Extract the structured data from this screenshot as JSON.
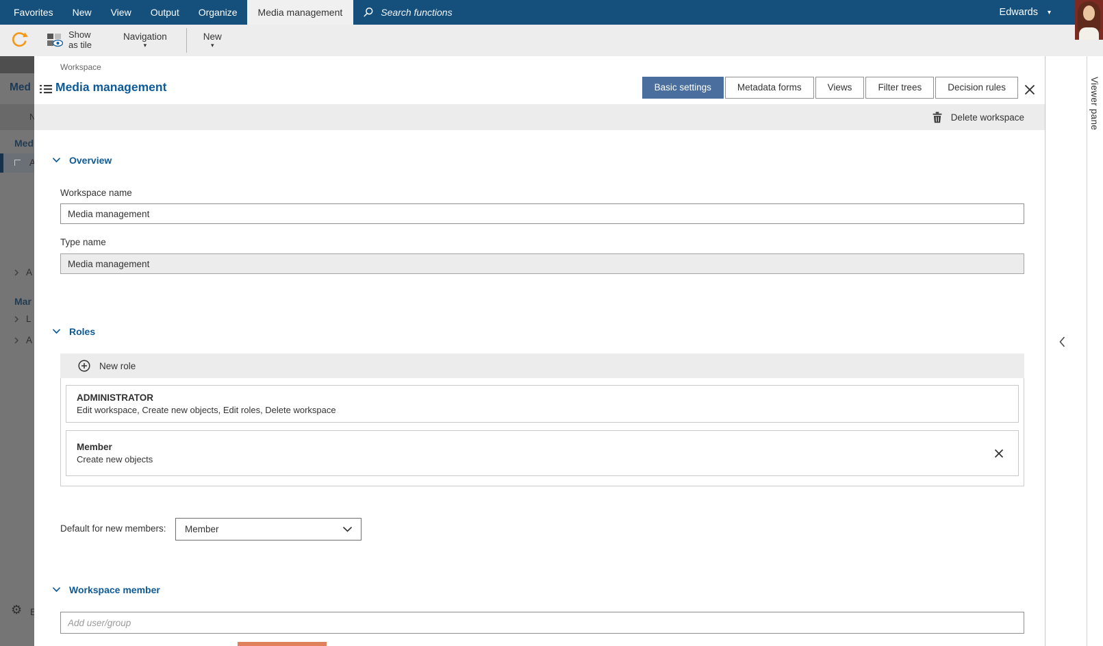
{
  "colors": {
    "navbar": "#154f7c",
    "accent_blue": "#0d5a96",
    "active_tab": "#4a6f9e",
    "refresh_orange": "#f49819",
    "salmon_bar": "#e0815e",
    "bar_gray": "#ececec"
  },
  "topnav": {
    "items": [
      "Favorites",
      "New",
      "View",
      "Output",
      "Organize"
    ],
    "active_item": "Media management",
    "search_placeholder": "Search functions",
    "user_name": "Edwards"
  },
  "toolbar": {
    "show_as_tile": "Show as tile",
    "navigation": "Navigation",
    "new": "New"
  },
  "workspace_panel": {
    "breadcrumb": "Workspace",
    "title": "Media management",
    "tabs": [
      {
        "label": "Basic settings",
        "active": true
      },
      {
        "label": "Metadata forms",
        "active": false
      },
      {
        "label": "Views",
        "active": false
      },
      {
        "label": "Filter trees",
        "active": false
      },
      {
        "label": "Decision rules",
        "active": false
      }
    ],
    "delete_button": "Delete workspace",
    "overview": {
      "heading": "Overview",
      "workspace_name_label": "Workspace name",
      "workspace_name_value": "Media management",
      "type_name_label": "Type name",
      "type_name_value": "Media management"
    },
    "roles": {
      "heading": "Roles",
      "new_role_button": "New role",
      "cards": [
        {
          "name": "ADMINISTRATOR",
          "permissions": "Edit workspace, Create new objects, Edit roles, Delete workspace"
        },
        {
          "name": "Member",
          "permissions": "Create new objects"
        }
      ],
      "default_label": "Default for new members:",
      "default_value": "Member"
    },
    "members": {
      "heading": "Workspace member",
      "add_placeholder": "Add user/group"
    }
  },
  "viewer_pane": {
    "label": "Viewer pane"
  },
  "dimmed_background": {
    "page_title": "Med",
    "toolbar_text": "N",
    "group1": "Med",
    "selected_item": "A",
    "item_a": "A",
    "group2": "Mar",
    "item_l": "L",
    "item_a2": "A",
    "settings": "E"
  }
}
